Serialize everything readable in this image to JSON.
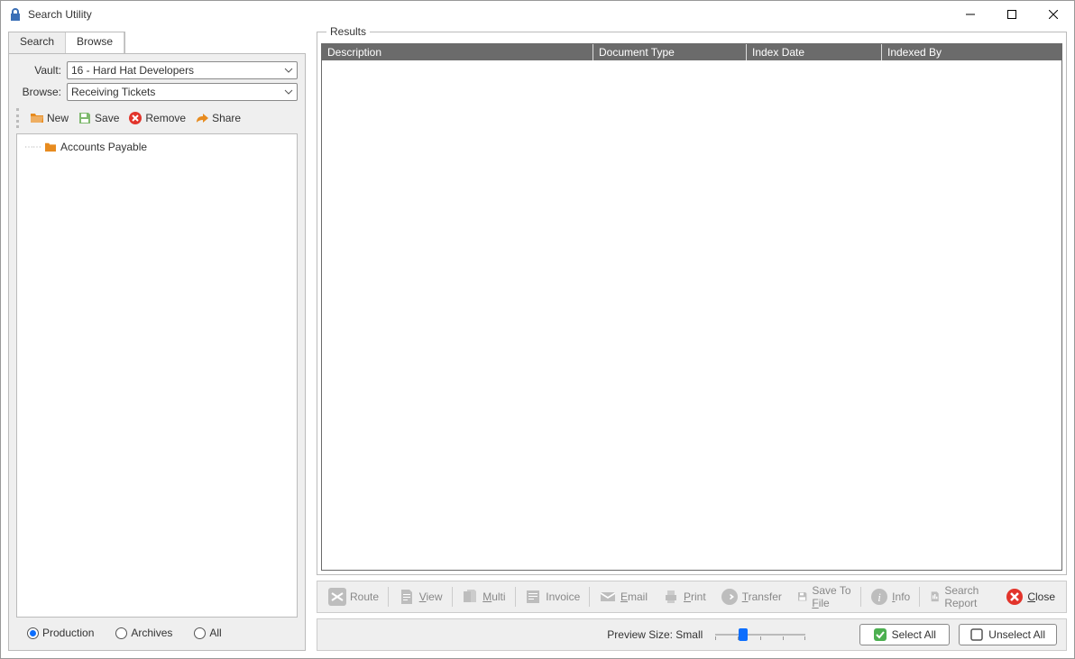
{
  "window": {
    "title": "Search Utility"
  },
  "tabs": {
    "search": "Search",
    "browse": "Browse",
    "active": "browse"
  },
  "fields": {
    "vault_label": "Vault:",
    "vault_value": "16 - Hard Hat Developers",
    "browse_label": "Browse:",
    "browse_value": "Receiving Tickets"
  },
  "miniToolbar": {
    "new": "New",
    "save": "Save",
    "remove": "Remove",
    "share": "Share"
  },
  "tree": {
    "items": [
      {
        "label": "Accounts Payable"
      }
    ]
  },
  "radios": {
    "production": "Production",
    "archives": "Archives",
    "all": "All",
    "selected": "production"
  },
  "results": {
    "group_label": "Results",
    "columns": [
      "Description",
      "Document Type",
      "Index Date",
      "Indexed By"
    ]
  },
  "actions": {
    "route": "Route",
    "view": "View",
    "multi": "Multi",
    "invoice": "Invoice",
    "email": "Email",
    "print": "Print",
    "transfer": "Transfer",
    "saveToFile": "Save To File",
    "info": "Info",
    "searchReport": "Search Report",
    "close": "Close"
  },
  "underlines": {
    "view": "V",
    "multi": "M",
    "email": "E",
    "print": "P",
    "transfer": "T",
    "saveToFile": "F",
    "info": "I",
    "close": "C"
  },
  "bottom": {
    "preview_label": "Preview Size: Small",
    "select_all": "Select All",
    "unselect_all": "Unselect All"
  }
}
